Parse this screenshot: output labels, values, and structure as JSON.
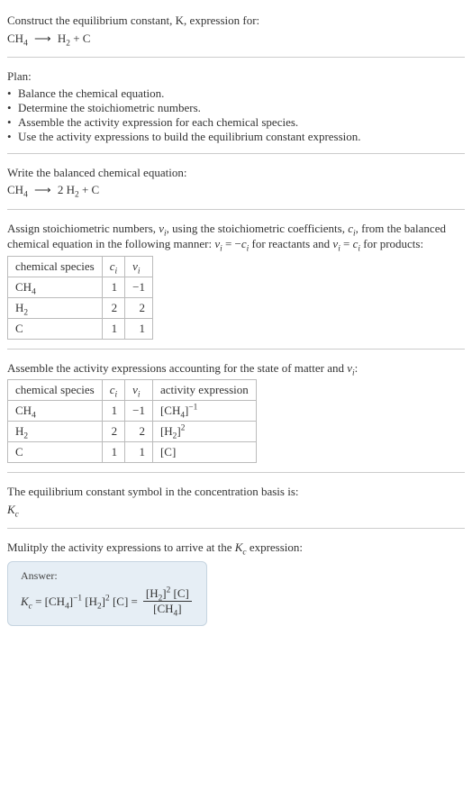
{
  "header": {
    "prompt": "Construct the equilibrium constant, K, expression for:",
    "equation_html": "CH<sub>4</sub> <span class='arrow'>⟶</span> H<sub>2</sub> + C"
  },
  "plan": {
    "title": "Plan:",
    "items": [
      "Balance the chemical equation.",
      "Determine the stoichiometric numbers.",
      "Assemble the activity expression for each chemical species.",
      "Use the activity expressions to build the equilibrium constant expression."
    ]
  },
  "balanced": {
    "intro": "Write the balanced chemical equation:",
    "equation_html": "CH<sub>4</sub> <span class='arrow'>⟶</span> 2 H<sub>2</sub> + C"
  },
  "stoich": {
    "intro_html": "Assign stoichiometric numbers, <span class='ital'>ν<sub>i</sub></span>, using the stoichiometric coefficients, <span class='ital'>c<sub>i</sub></span>, from the balanced chemical equation in the following manner: <span class='ital'>ν<sub>i</sub></span> = −<span class='ital'>c<sub>i</sub></span> for reactants and <span class='ital'>ν<sub>i</sub></span> = <span class='ital'>c<sub>i</sub></span> for products:",
    "headers": {
      "species": "chemical species",
      "ci_html": "<span class='ital'>c<sub>i</sub></span>",
      "vi_html": "<span class='ital'>ν<sub>i</sub></span>"
    },
    "rows": [
      {
        "species_html": "CH<sub>4</sub>",
        "ci": "1",
        "vi": "−1"
      },
      {
        "species_html": "H<sub>2</sub>",
        "ci": "2",
        "vi": "2"
      },
      {
        "species_html": "C",
        "ci": "1",
        "vi": "1"
      }
    ]
  },
  "activity": {
    "intro_html": "Assemble the activity expressions accounting for the state of matter and <span class='ital'>ν<sub>i</sub></span>:",
    "headers": {
      "species": "chemical species",
      "ci_html": "<span class='ital'>c<sub>i</sub></span>",
      "vi_html": "<span class='ital'>ν<sub>i</sub></span>",
      "act": "activity expression"
    },
    "rows": [
      {
        "species_html": "CH<sub>4</sub>",
        "ci": "1",
        "vi": "−1",
        "act_html": "[CH<sub>4</sub>]<sup>−1</sup>"
      },
      {
        "species_html": "H<sub>2</sub>",
        "ci": "2",
        "vi": "2",
        "act_html": "[H<sub>2</sub>]<sup>2</sup>"
      },
      {
        "species_html": "C",
        "ci": "1",
        "vi": "1",
        "act_html": "[C]"
      }
    ]
  },
  "symbol": {
    "intro": "The equilibrium constant symbol in the concentration basis is:",
    "value_html": "<span class='ital'>K<sub>c</sub></span>"
  },
  "final": {
    "intro_html": "Mulitply the activity expressions to arrive at the <span class='ital'>K<sub>c</sub></span> expression:",
    "answer_label": "Answer:",
    "lhs_html": "<span class='ital'>K<sub>c</sub></span> = [CH<sub>4</sub>]<sup>−1</sup> [H<sub>2</sub>]<sup>2</sup> [C] =",
    "frac_num_html": "[H<sub>2</sub>]<sup>2</sup> [C]",
    "frac_den_html": "[CH<sub>4</sub>]"
  },
  "chart_data": {
    "type": "table",
    "tables": [
      {
        "title": "Stoichiometric numbers",
        "columns": [
          "chemical species",
          "c_i",
          "ν_i"
        ],
        "rows": [
          [
            "CH4",
            1,
            -1
          ],
          [
            "H2",
            2,
            2
          ],
          [
            "C",
            1,
            1
          ]
        ]
      },
      {
        "title": "Activity expressions",
        "columns": [
          "chemical species",
          "c_i",
          "ν_i",
          "activity expression"
        ],
        "rows": [
          [
            "CH4",
            1,
            -1,
            "[CH4]^-1"
          ],
          [
            "H2",
            2,
            2,
            "[H2]^2"
          ],
          [
            "C",
            1,
            1,
            "[C]"
          ]
        ]
      }
    ]
  }
}
